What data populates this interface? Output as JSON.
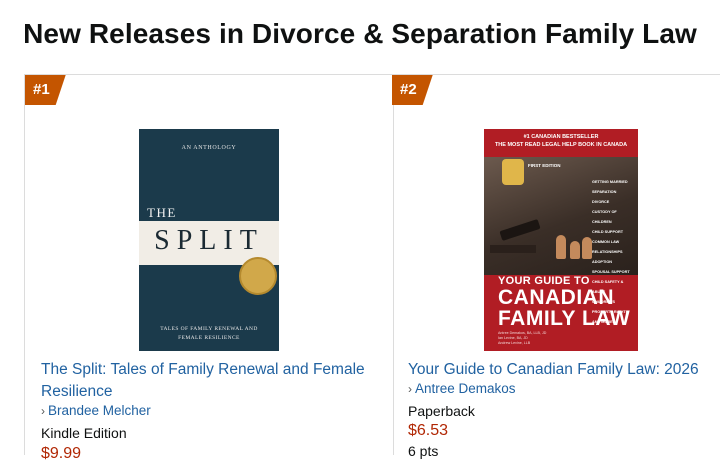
{
  "page": {
    "title": "New Releases in Divorce & Separation Family Law"
  },
  "items": [
    {
      "rank": "#1",
      "title": "The Split: Tales of Family Renewal and Female Resilience",
      "author": "Brandee Melcher",
      "format": "Kindle Edition",
      "price": "$9.99",
      "cover": {
        "top_line": "AN ANTHOLOGY",
        "the": "THE",
        "split": "SPLIT",
        "subtitle_line1": "TALES OF FAMILY RENEWAL AND",
        "subtitle_line2": "FEMALE RESILIENCE",
        "colors": {
          "background": "#1b3a4b",
          "band": "#f1ede6",
          "seal": "#d1a84a"
        }
      }
    },
    {
      "rank": "#2",
      "title": "Your Guide to Canadian Family Law: 2026",
      "author": "Antree Demakos",
      "format": "Paperback",
      "price": "$6.53",
      "price_sub": "6 pts",
      "cover": {
        "bestseller": "#1 CANADIAN BESTSELLER",
        "tagline": "THE MOST READ LEGAL HELP BOOK IN CANADA",
        "edition": "FIRST EDITION",
        "topics": [
          "GETTING MARRIED",
          "SEPARATION",
          "DIVORCE",
          "CUSTODY OF CHILDREN",
          "CHILD SUPPORT",
          "COMMON LAW RELATIONSHIPS",
          "ADOPTION",
          "SPOUSAL SUPPORT",
          "CHILD SAFETY & ABUSE",
          "CHILDREN'S PROPERTY RIGHTS",
          "AND MORE..."
        ],
        "your_guide_to": "YOUR GUIDE TO",
        "big_title_line1": "CANADIAN",
        "big_title_line2": "FAMILY LAW",
        "authors_line1": "Antree Demakos, BA, LLB, JD",
        "authors_line2": "Ian Levine, BA, JD",
        "authors_line3": "Andrew Levine, LLB",
        "colors": {
          "background": "#b11d24"
        }
      }
    }
  ],
  "colors": {
    "link": "#2162a1",
    "price": "#b12704",
    "rank_badge": "#c45500"
  },
  "icons": {
    "author_chevron": "chevron-right-icon"
  }
}
